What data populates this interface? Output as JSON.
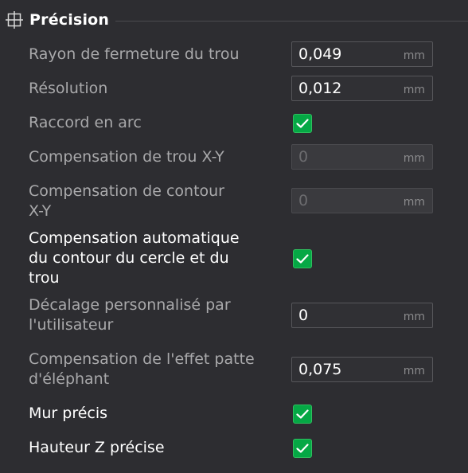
{
  "section": {
    "title": "Précision",
    "icon": "crosshair-icon"
  },
  "colors": {
    "accent": "#05a845",
    "background": "#2d2d31",
    "label": "#a9a9ab",
    "label_active": "#ffffff"
  },
  "settings": [
    {
      "label": "Rayon de fermeture du trou",
      "type": "number",
      "value": "0,049",
      "unit": "mm"
    },
    {
      "label": "Résolution",
      "type": "number",
      "value": "0,012",
      "unit": "mm"
    },
    {
      "label": "Raccord en arc",
      "type": "checkbox",
      "checked": true
    },
    {
      "label": "Compensation de trou X-Y",
      "type": "number",
      "value": "0",
      "unit": "mm",
      "disabled": true
    },
    {
      "label": "Compensation de contour X-Y",
      "type": "number",
      "value": "0",
      "unit": "mm",
      "disabled": true
    },
    {
      "label": "Compensation automatique du contour du cercle et du trou",
      "type": "checkbox",
      "checked": true
    },
    {
      "label": "Décalage personnalisé par l'utilisateur",
      "type": "number",
      "value": "0",
      "unit": "mm"
    },
    {
      "label": "Compensation de l'effet patte d'éléphant",
      "type": "number",
      "value": "0,075",
      "unit": "mm"
    },
    {
      "label": "Mur précis",
      "type": "checkbox",
      "checked": true
    },
    {
      "label": "Hauteur Z précise",
      "type": "checkbox",
      "checked": true
    }
  ]
}
